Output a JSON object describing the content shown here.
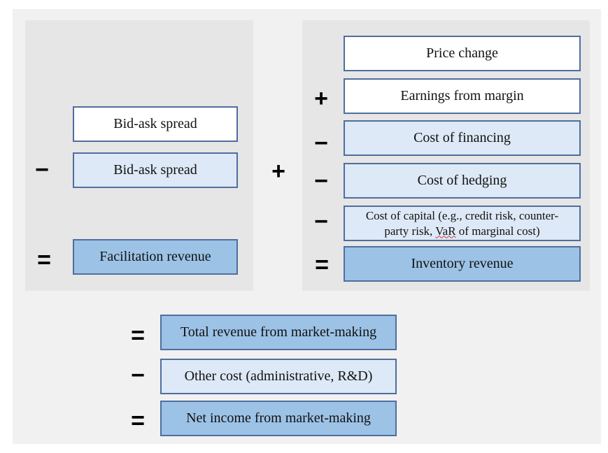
{
  "left_panel": {
    "items": [
      {
        "op": "",
        "label": "Bid-ask spread",
        "style": "white"
      },
      {
        "op": "−",
        "label": "Bid-ask spread",
        "style": "light"
      },
      {
        "op": "=",
        "label": "Facilitation revenue",
        "style": "dark"
      }
    ]
  },
  "between_panels_op": "+",
  "right_panel": {
    "items": [
      {
        "op": "",
        "label": "Price change",
        "style": "white"
      },
      {
        "op": "+",
        "label": "Earnings from margin",
        "style": "white"
      },
      {
        "op": "−",
        "label": "Cost of financing",
        "style": "light"
      },
      {
        "op": "−",
        "label": "Cost of hedging",
        "style": "light"
      },
      {
        "op": "−",
        "label_line1": "Cost of capital (e.g., credit risk, counter-",
        "label_line2_pre": "party risk, ",
        "label_line2_flag": "VaR",
        "label_line2_post": " of marginal cost)",
        "style": "light"
      },
      {
        "op": "=",
        "label": "Inventory revenue",
        "style": "dark"
      }
    ]
  },
  "bottom": {
    "items": [
      {
        "op": "=",
        "label": "Total revenue from market-making",
        "style": "dark"
      },
      {
        "op": "−",
        "label": "Other cost (administrative, R&D)",
        "style": "light"
      },
      {
        "op": "=",
        "label": "Net income from market-making",
        "style": "dark"
      }
    ]
  },
  "colors": {
    "slide_bg": "#f1f1f1",
    "panel_bg": "#e6e6e6",
    "box_border": "#4f6e9f",
    "white_box": "#ffffff",
    "light_box": "#dde9f6",
    "dark_box": "#9cc2e6"
  }
}
